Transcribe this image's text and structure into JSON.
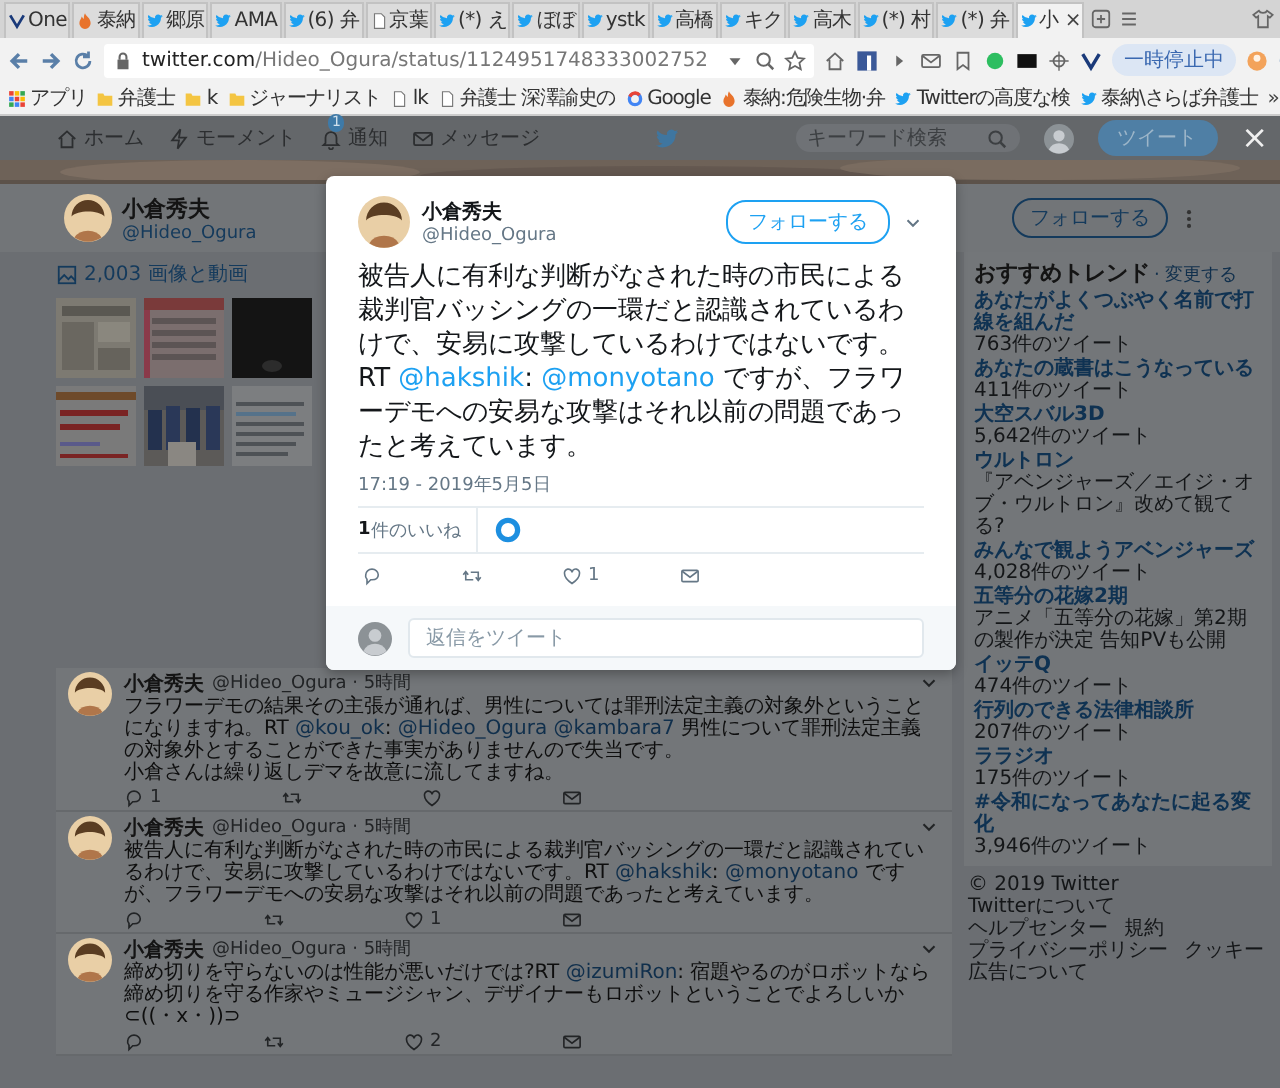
{
  "browser": {
    "tabs": [
      {
        "label": "One",
        "kind": "v",
        "selected": false
      },
      {
        "label": "泰納",
        "kind": "flame",
        "selected": false
      },
      {
        "label": "郷原",
        "kind": "bird",
        "selected": false
      },
      {
        "label": "AMA",
        "kind": "bird",
        "selected": false
      },
      {
        "label": "(6) 弁",
        "kind": "bird",
        "selected": false
      },
      {
        "label": "京葉",
        "kind": "page",
        "selected": false
      },
      {
        "label": "(*) え",
        "kind": "bird",
        "selected": false
      },
      {
        "label": "ぼぼ",
        "kind": "bird",
        "selected": false
      },
      {
        "label": "ystk",
        "kind": "bird",
        "selected": false
      },
      {
        "label": "高橋",
        "kind": "bird",
        "selected": false
      },
      {
        "label": "キク",
        "kind": "bird",
        "selected": false
      },
      {
        "label": "高木",
        "kind": "bird",
        "selected": false
      },
      {
        "label": "(*) 村",
        "kind": "bird",
        "selected": false
      },
      {
        "label": "(*) 弁",
        "kind": "bird",
        "selected": false
      },
      {
        "label": "小",
        "kind": "bird",
        "selected": true
      }
    ],
    "tab_close": "×",
    "url": {
      "host": "twitter.com",
      "path": "/Hideo_Ogura/status/1124951748333002752"
    },
    "pause_button": "一時停止中",
    "bookmarks": [
      {
        "label": "アプリ",
        "kind": "apps"
      },
      {
        "label": "弁護士",
        "kind": "folder"
      },
      {
        "label": "k",
        "kind": "folder"
      },
      {
        "label": "ジャーナリスト",
        "kind": "folder"
      },
      {
        "label": "lk",
        "kind": "page"
      },
      {
        "label": "弁護士 深澤諭史の",
        "kind": "page"
      },
      {
        "label": "Google",
        "kind": "ring"
      },
      {
        "label": "泰納:危険生物·弁",
        "kind": "flame"
      },
      {
        "label": "Twitterの高度な検",
        "kind": "bird"
      },
      {
        "label": "泰納\\さらば弁護士",
        "kind": "bird"
      }
    ],
    "more_bookmarks": "»"
  },
  "nav": {
    "items": [
      {
        "label": "ホーム",
        "kind": "home"
      },
      {
        "label": "モーメント",
        "kind": "bolt"
      },
      {
        "label": "通知",
        "kind": "bell",
        "badge": "1"
      },
      {
        "label": "メッセージ",
        "kind": "mail"
      }
    ],
    "search": {
      "placeholder": "キーワード検索"
    },
    "tweet_button": "ツイート",
    "close": "×"
  },
  "profile": {
    "name": "小倉秀夫",
    "handle": "@Hideo_Ogura",
    "follow_button": "フォローする"
  },
  "media": {
    "label": "2,003 画像と動画"
  },
  "tweets": [
    {
      "name": "小倉秀夫",
      "handle": "@Hideo_Ogura · 5時間",
      "segments": [
        {
          "kind": "text",
          "text": "フラワーデモの結果その主張が通れば、男性については罪刑法定主義の対象外ということになりますね。RT "
        },
        {
          "kind": "link",
          "text": "@kou_ok"
        },
        {
          "kind": "text",
          "text": ": "
        },
        {
          "kind": "link",
          "text": "@Hideo_Ogura "
        },
        {
          "kind": "link",
          "text": "@kambara7"
        },
        {
          "kind": "text",
          "text": " 男性について罪刑法定主義の対象外とすることができた事実がありませんので失当です。"
        },
        {
          "kind": "newline",
          "text": "小倉さんは繰り返しデマを故意に流してますね。"
        }
      ],
      "reply_count": "1"
    },
    {
      "name": "小倉秀夫",
      "handle": "@Hideo_Ogura · 5時間",
      "segments": [
        {
          "kind": "text",
          "text": "被告人に有利な判断がなされた時の市民による裁判官バッシングの一環だと認識されているわけで、安易に攻撃しているわけではないです。RT "
        },
        {
          "kind": "link",
          "text": "@hakshik"
        },
        {
          "kind": "text",
          "text": ": "
        },
        {
          "kind": "link",
          "text": "@monyotano"
        },
        {
          "kind": "text",
          "text": " ですが、フラワーデモへの安易な攻撃はそれ以前の問題であったと考えています。"
        }
      ],
      "like_count": "1"
    },
    {
      "name": "小倉秀夫",
      "handle": "@Hideo_Ogura · 5時間",
      "segments": [
        {
          "kind": "text",
          "text": "締め切りを守らないのは性能が悪いだけでは?RT "
        },
        {
          "kind": "link",
          "text": "@izumiRon"
        },
        {
          "kind": "text",
          "text": ": 宿題やるのがロボットなら締め切りを守る作家やミュージシャン、デザイナーもロボットということでよろしいか⊂((・x・))⊃"
        }
      ],
      "like_count": "2"
    }
  ],
  "trends": {
    "title": "おすすめトレンド",
    "change_link": "· 変更する",
    "items": [
      {
        "name": "あなたがよくつぶやく名前で打線を組んだ",
        "meta": "763件のツイート"
      },
      {
        "name": "あなたの蔵書はこうなっている",
        "meta": "411件のツイート"
      },
      {
        "name": "大空スバル3D",
        "meta": "5,642件のツイート"
      },
      {
        "name": "ウルトロン",
        "meta": "『アベンジャーズ／エイジ・オブ・ウルトロン』改めて観てる?"
      },
      {
        "name": "みんなで観ようアベンジャーズ",
        "meta": "4,028件のツイート"
      },
      {
        "name": "五等分の花嫁2期",
        "meta": "アニメ「五等分の花嫁」第2期の製作が決定 告知PVも公開"
      },
      {
        "name": "イッテQ",
        "meta": "474件のツイート"
      },
      {
        "name": "行列のできる法律相談所",
        "meta": "207件のツイート"
      },
      {
        "name": "ララジオ",
        "meta": "175件のツイート"
      },
      {
        "name": "#令和になってあなたに起る変化",
        "meta": "3,946件のツイート"
      }
    ]
  },
  "footer": [
    "© 2019 Twitter",
    "Twitterについて",
    "ヘルプセンター",
    "規約",
    "プライバシーポリシー",
    "クッキー",
    "広告について"
  ],
  "modal": {
    "name": "小倉秀夫",
    "handle": "@Hideo_Ogura",
    "follow_button": "フォローする",
    "segments": [
      {
        "kind": "text",
        "text": "被告人に有利な判断がなされた時の市民による裁判官バッシングの一環だと認識されているわけで、安易に攻撃しているわけではないです。RT "
      },
      {
        "kind": "link",
        "text": "@hakshik"
      },
      {
        "kind": "text",
        "text": ": "
      },
      {
        "kind": "link",
        "text": "@monyotano"
      },
      {
        "kind": "text",
        "text": " ですが、フラワーデモへの安易な攻撃はそれ以前の問題であったと考えています。"
      }
    ],
    "timestamp": "17:19 - 2019年5月5日",
    "likes_label": "**1**件のいいね",
    "like_count": "1",
    "reply_placeholder": "返信をツイート"
  }
}
